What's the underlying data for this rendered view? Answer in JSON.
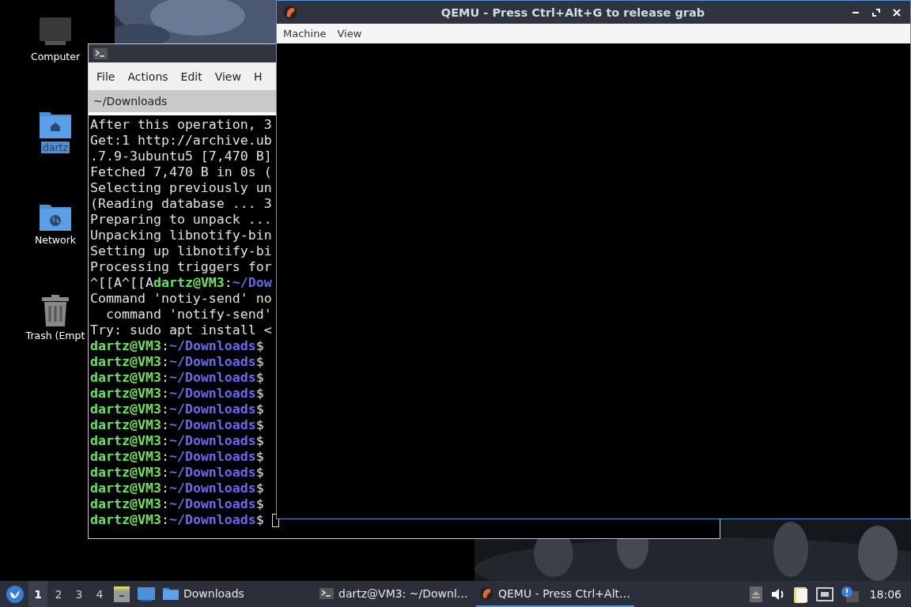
{
  "desktop_icons": [
    {
      "label": "Computer",
      "kind": "computer",
      "selected": false
    },
    {
      "label": "dartz",
      "kind": "home",
      "selected": true
    },
    {
      "label": "Network",
      "kind": "network",
      "selected": false
    },
    {
      "label": "Trash (Empt",
      "kind": "trash",
      "selected": false
    }
  ],
  "terminal": {
    "menu": [
      "File",
      "Actions",
      "Edit",
      "View",
      "H"
    ],
    "tab": "~/Downloads",
    "lines": [
      {
        "cursor": false,
        "parts": [
          {
            "kind": "plain",
            "text": "After this operation, 3"
          }
        ]
      },
      {
        "cursor": false,
        "parts": [
          {
            "kind": "plain",
            "text": "Get:1 http://archive.ub"
          }
        ]
      },
      {
        "cursor": false,
        "parts": [
          {
            "kind": "plain",
            "text": ".7.9-3ubuntu5 [7,470 B]"
          }
        ]
      },
      {
        "cursor": false,
        "parts": [
          {
            "kind": "plain",
            "text": "Fetched 7,470 B in 0s ("
          }
        ]
      },
      {
        "cursor": false,
        "parts": [
          {
            "kind": "plain",
            "text": "Selecting previously un"
          }
        ]
      },
      {
        "cursor": false,
        "parts": [
          {
            "kind": "plain",
            "text": "(Reading database ... 3"
          }
        ]
      },
      {
        "cursor": false,
        "parts": [
          {
            "kind": "plain",
            "text": "Preparing to unpack ..."
          }
        ]
      },
      {
        "cursor": false,
        "parts": [
          {
            "kind": "plain",
            "text": "Unpacking libnotify-bin"
          }
        ]
      },
      {
        "cursor": false,
        "parts": [
          {
            "kind": "plain",
            "text": "Setting up libnotify-bi"
          }
        ]
      },
      {
        "cursor": false,
        "parts": [
          {
            "kind": "plain",
            "text": "Processing triggers for"
          }
        ]
      },
      {
        "cursor": false,
        "parts": [
          {
            "kind": "plain",
            "text": "^[[A^[[A"
          },
          {
            "kind": "user",
            "text": "dartz@VM3"
          },
          {
            "kind": "plain",
            "text": ":"
          },
          {
            "kind": "path",
            "text": "~/Dow"
          }
        ]
      },
      {
        "cursor": false,
        "parts": [
          {
            "kind": "plain",
            "text": "Command 'notiy-send' no"
          }
        ]
      },
      {
        "cursor": false,
        "parts": [
          {
            "kind": "plain",
            "text": "  command 'notify-send'"
          }
        ]
      },
      {
        "cursor": false,
        "parts": [
          {
            "kind": "plain",
            "text": "Try: sudo apt install <"
          }
        ]
      },
      {
        "cursor": false,
        "parts": [
          {
            "kind": "user",
            "text": "dartz@VM3"
          },
          {
            "kind": "plain",
            "text": ":"
          },
          {
            "kind": "path",
            "text": "~/Downloads"
          },
          {
            "kind": "plain",
            "text": "$"
          }
        ]
      },
      {
        "cursor": false,
        "parts": [
          {
            "kind": "user",
            "text": "dartz@VM3"
          },
          {
            "kind": "plain",
            "text": ":"
          },
          {
            "kind": "path",
            "text": "~/Downloads"
          },
          {
            "kind": "plain",
            "text": "$"
          }
        ]
      },
      {
        "cursor": false,
        "parts": [
          {
            "kind": "user",
            "text": "dartz@VM3"
          },
          {
            "kind": "plain",
            "text": ":"
          },
          {
            "kind": "path",
            "text": "~/Downloads"
          },
          {
            "kind": "plain",
            "text": "$"
          }
        ]
      },
      {
        "cursor": false,
        "parts": [
          {
            "kind": "user",
            "text": "dartz@VM3"
          },
          {
            "kind": "plain",
            "text": ":"
          },
          {
            "kind": "path",
            "text": "~/Downloads"
          },
          {
            "kind": "plain",
            "text": "$"
          }
        ]
      },
      {
        "cursor": false,
        "parts": [
          {
            "kind": "user",
            "text": "dartz@VM3"
          },
          {
            "kind": "plain",
            "text": ":"
          },
          {
            "kind": "path",
            "text": "~/Downloads"
          },
          {
            "kind": "plain",
            "text": "$"
          }
        ]
      },
      {
        "cursor": false,
        "parts": [
          {
            "kind": "user",
            "text": "dartz@VM3"
          },
          {
            "kind": "plain",
            "text": ":"
          },
          {
            "kind": "path",
            "text": "~/Downloads"
          },
          {
            "kind": "plain",
            "text": "$"
          }
        ]
      },
      {
        "cursor": false,
        "parts": [
          {
            "kind": "user",
            "text": "dartz@VM3"
          },
          {
            "kind": "plain",
            "text": ":"
          },
          {
            "kind": "path",
            "text": "~/Downloads"
          },
          {
            "kind": "plain",
            "text": "$"
          }
        ]
      },
      {
        "cursor": false,
        "parts": [
          {
            "kind": "user",
            "text": "dartz@VM3"
          },
          {
            "kind": "plain",
            "text": ":"
          },
          {
            "kind": "path",
            "text": "~/Downloads"
          },
          {
            "kind": "plain",
            "text": "$"
          }
        ]
      },
      {
        "cursor": false,
        "parts": [
          {
            "kind": "user",
            "text": "dartz@VM3"
          },
          {
            "kind": "plain",
            "text": ":"
          },
          {
            "kind": "path",
            "text": "~/Downloads"
          },
          {
            "kind": "plain",
            "text": "$"
          }
        ]
      },
      {
        "cursor": false,
        "parts": [
          {
            "kind": "user",
            "text": "dartz@VM3"
          },
          {
            "kind": "plain",
            "text": ":"
          },
          {
            "kind": "path",
            "text": "~/Downloads"
          },
          {
            "kind": "plain",
            "text": "$"
          }
        ]
      },
      {
        "cursor": false,
        "parts": [
          {
            "kind": "user",
            "text": "dartz@VM3"
          },
          {
            "kind": "plain",
            "text": ":"
          },
          {
            "kind": "path",
            "text": "~/Downloads"
          },
          {
            "kind": "plain",
            "text": "$"
          }
        ]
      },
      {
        "cursor": true,
        "parts": [
          {
            "kind": "user",
            "text": "dartz@VM3"
          },
          {
            "kind": "plain",
            "text": ":"
          },
          {
            "kind": "path",
            "text": "~/Downloads"
          },
          {
            "kind": "plain",
            "text": "$"
          }
        ]
      }
    ]
  },
  "qemu": {
    "title": "QEMU - Press Ctrl+Alt+G to release grab",
    "menu": [
      "Machine",
      "View"
    ]
  },
  "taskbar": {
    "workspaces": [
      {
        "label": "1",
        "selected": true
      },
      {
        "label": "2",
        "selected": false
      },
      {
        "label": "3",
        "selected": false
      },
      {
        "label": "4",
        "selected": false
      }
    ],
    "tasks": [
      {
        "label": "Downloads",
        "kind": "folder",
        "selected": false
      },
      {
        "label": "dartz@VM3: ~/Downl…",
        "kind": "terminal",
        "selected": false
      },
      {
        "label": "QEMU - Press Ctrl+Alt…",
        "kind": "qemu",
        "selected": true
      }
    ],
    "clock": "18:06"
  }
}
